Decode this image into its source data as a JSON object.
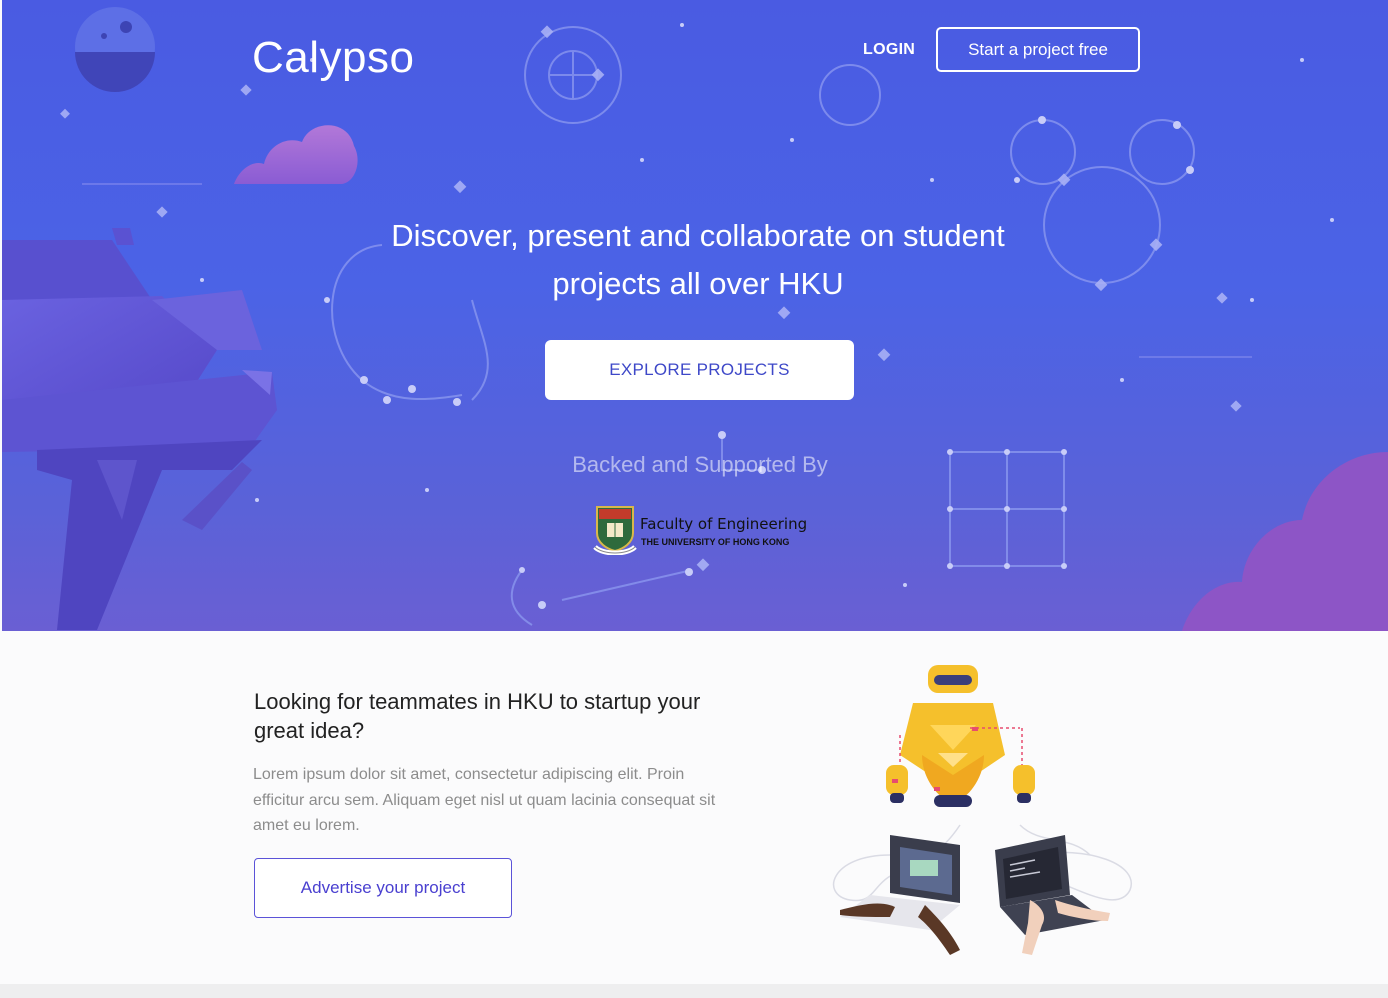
{
  "header": {
    "logo": "Calypso",
    "login_label": "LOGIN",
    "cta_label": "Start a project free"
  },
  "hero": {
    "headline": "Discover, present and collaborate on student projects all over HKU",
    "explore_label": "EXPLORE PROJECTS",
    "backed_label": "Backed and Supported By",
    "sponsor": {
      "name": "Faculty of Engineering",
      "university": "THE UNIVERSITY OF HONG KONG"
    }
  },
  "feature": {
    "title": "Looking for teammates in HKU to startup your great idea?",
    "body": "Lorem ipsum dolor sit amet, consectetur adipiscing elit. Proin efficitur arcu sem. Aliquam eget nisl ut quam lacinia consequat sit amet eu lorem.",
    "button_label": "Advertise your project"
  },
  "colors": {
    "hero_blue": "#4a5be2",
    "accent_purple": "#5b53d8",
    "robot_yellow": "#f5c02c"
  },
  "icons": [
    "planet-icon",
    "cloud-icon",
    "constellation-icon",
    "robot-icon",
    "laptop-icon",
    "university-crest-icon"
  ]
}
